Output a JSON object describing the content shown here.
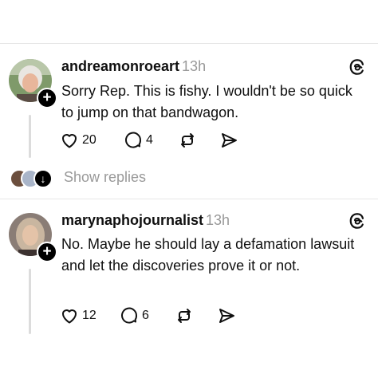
{
  "posts": [
    {
      "username": "andreamonroeart",
      "time": "13h",
      "text": "Sorry Rep. This is fishy. I wouldn't be so quick to jump on that bandwagon.",
      "likes": "20",
      "replies": "4",
      "icons": [
        "heart-icon",
        "comment-icon",
        "repost-icon",
        "share-icon"
      ]
    },
    {
      "username": "maryna­phojournalist",
      "time": "13h",
      "text": "No. Maybe he should lay a defamation lawsuit and let the discoveries prove it or not.",
      "likes": "12",
      "replies": "6",
      "icons": [
        "heart-icon",
        "comment-icon",
        "repost-icon",
        "share-icon"
      ]
    }
  ],
  "show_replies_label": "Show replies",
  "colors": {
    "text": "#101010",
    "muted": "#999999",
    "divider": "#e6e6e6",
    "accent": "#000000"
  }
}
